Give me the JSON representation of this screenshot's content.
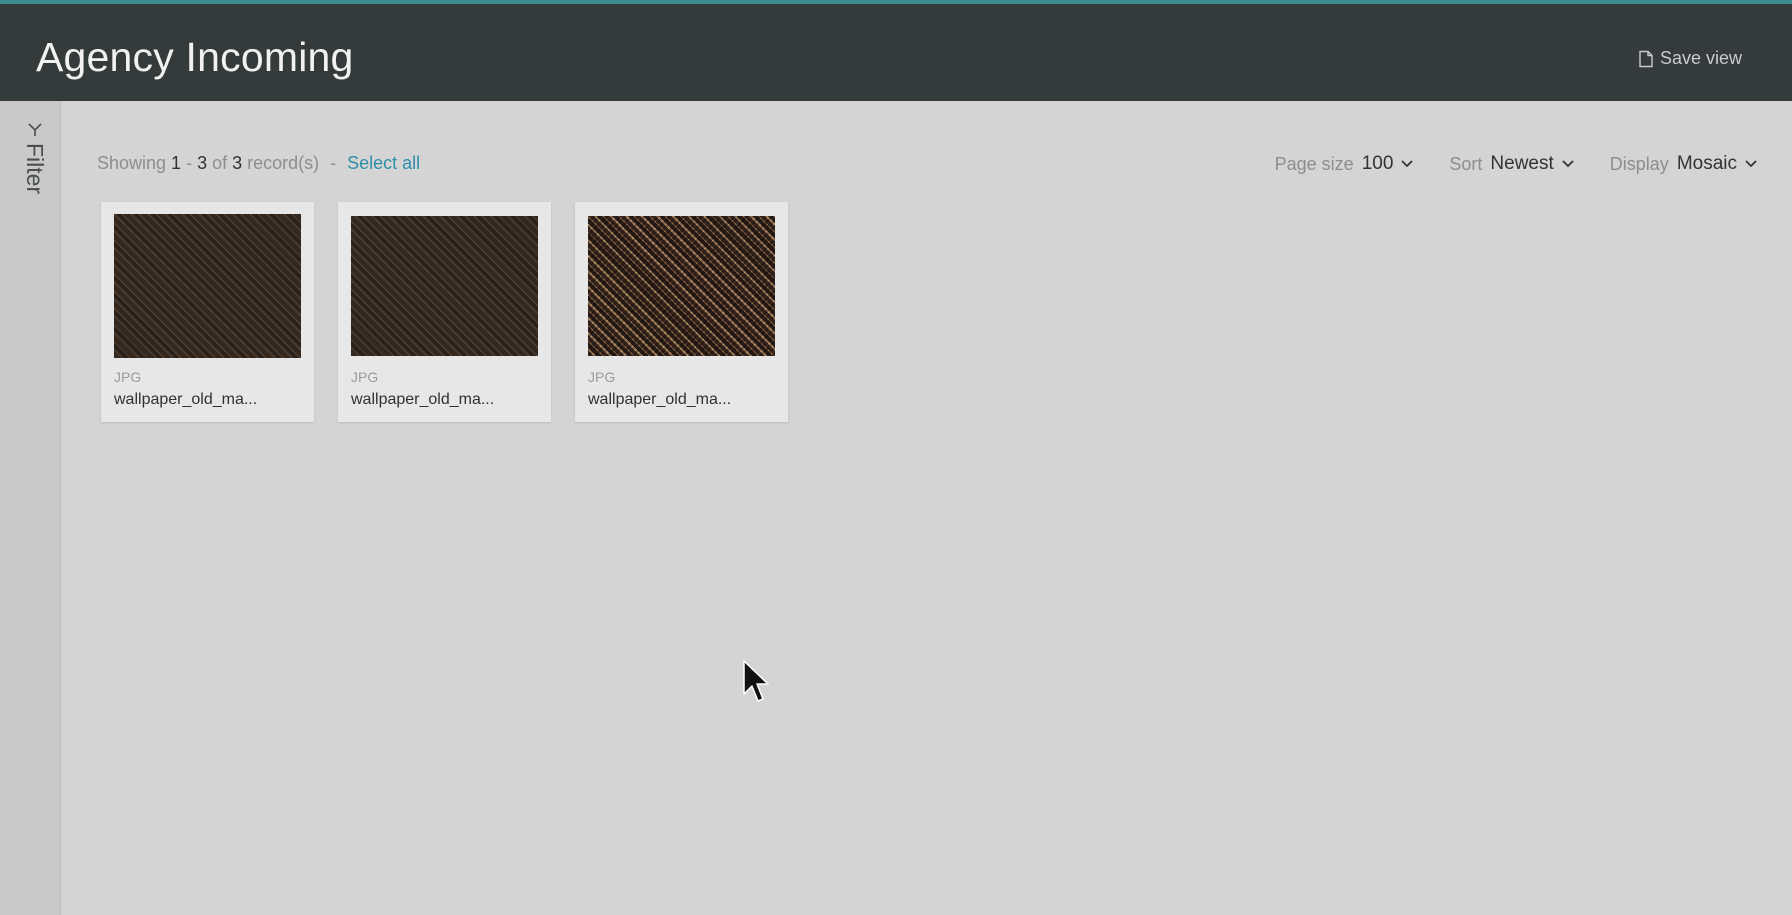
{
  "header": {
    "title": "Agency Incoming",
    "save_view_label": "Save view"
  },
  "sidebar": {
    "filter_label": "Filter"
  },
  "toolbar": {
    "showing_label": "Showing",
    "range_start": "1",
    "range_sep": "-",
    "range_end": "3",
    "of_label": "of",
    "total": "3",
    "records_label": "record(s)",
    "dash": "-",
    "select_all_label": "Select all",
    "page_size_label": "Page size",
    "page_size_value": "100",
    "sort_label": "Sort",
    "sort_value": "Newest",
    "display_label": "Display",
    "display_value": "Mosaic"
  },
  "items": [
    {
      "type": "JPG",
      "name": "wallpaper_old_ma..."
    },
    {
      "type": "JPG",
      "name": "wallpaper_old_ma..."
    },
    {
      "type": "JPG",
      "name": "wallpaper_old_ma..."
    }
  ],
  "colors": {
    "header_bg": "#353a3b",
    "accent": "#3c8a89",
    "link": "#2f8fa8",
    "content_bg": "#d4d4d4"
  }
}
